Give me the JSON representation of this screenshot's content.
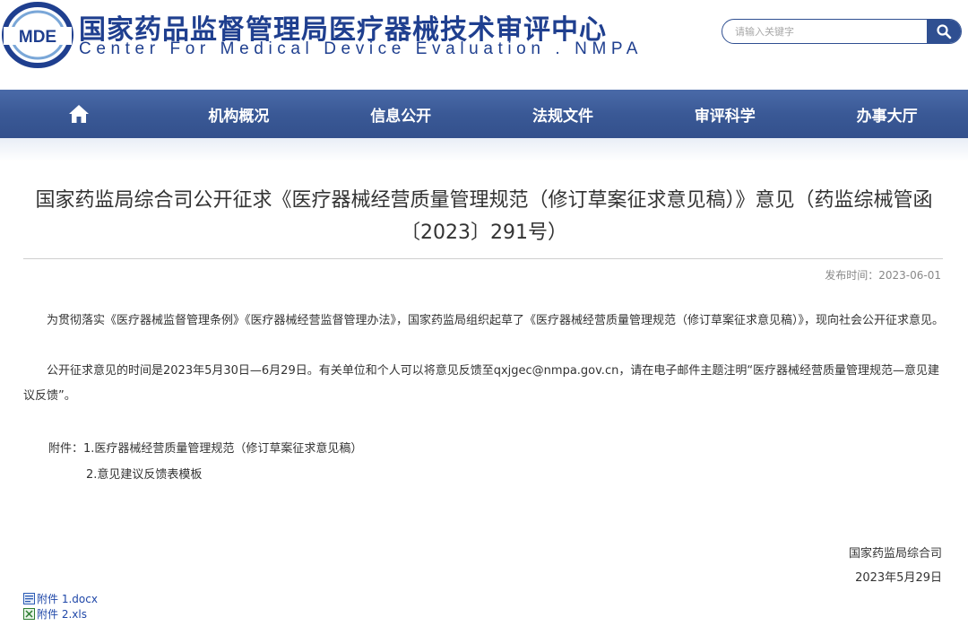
{
  "header": {
    "logo_text": "MDE",
    "title": "国家药品监督管理局医疗器械技术审评中心",
    "subtitle": "Center For Medical Device Evaluation . NMPA",
    "search_placeholder": "请输入关键字"
  },
  "nav": {
    "items": [
      {
        "label": "机构概况"
      },
      {
        "label": "信息公开"
      },
      {
        "label": "法规文件"
      },
      {
        "label": "审评科学"
      },
      {
        "label": "办事大厅"
      }
    ]
  },
  "article": {
    "title": "国家药监局综合司公开征求《医疗器械经营质量管理规范（修订草案征求意见稿）》意见（药监综械管函〔2023〕291号）",
    "publish_label": "发布时间：",
    "publish_date": "2023-06-01",
    "paragraph1": "为贯彻落实《医疗器械监督管理条例》《医疗器械经营监督管理办法》，国家药监局组织起草了《医疗器械经营质量管理规范（修订草案征求意见稿）》，现向社会公开征求意见。",
    "paragraph2": "公开征求意见的时间是2023年5月30日—6月29日。有关单位和个人可以将意见反馈至qxjgec@nmpa.gov.cn，请在电子邮件主题注明“医疗器械经营质量管理规范—意见建议反馈”。",
    "attachment_line1": "附件：1.医疗器械经营质量管理规范（修订草案征求意见稿）",
    "attachment_line2": "2.意见建议反馈表模板",
    "signature_org": "国家药监局综合司",
    "signature_date": "2023年5月29日",
    "files": [
      {
        "name": "附件 1.docx"
      },
      {
        "name": "附件 2.xls"
      }
    ]
  },
  "colors": {
    "brand_blue": "#1f3f8f",
    "nav_blue": "#3a5996",
    "link_blue": "#1f47a8"
  },
  "icons": [
    "mde-logo",
    "search-icon",
    "home-icon",
    "docx-file-icon",
    "xls-file-icon"
  ]
}
